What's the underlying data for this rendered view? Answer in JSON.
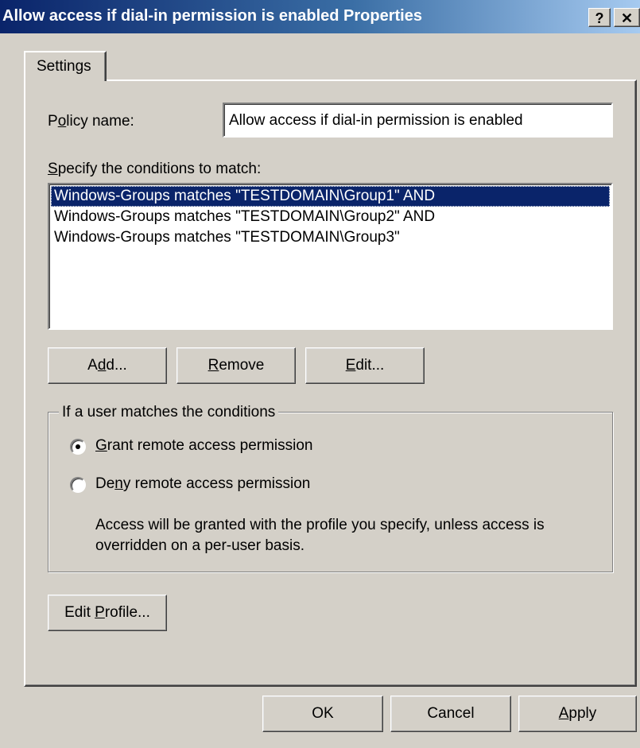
{
  "window": {
    "title": "Allow access if dial-in permission is enabled Properties",
    "help_button": "?",
    "close_button": "✕"
  },
  "tabs": [
    {
      "label": "Settings",
      "selected": true
    }
  ],
  "policy": {
    "label_prefix": "P",
    "label_accel": "o",
    "label_suffix": "licy name:",
    "value": "Allow access if dial-in permission is enabled"
  },
  "conditions": {
    "label_accel": "S",
    "label_suffix": "pecify the conditions to match:",
    "items": [
      "Windows-Groups matches \"TESTDOMAIN\\Group1\" AND",
      "Windows-Groups matches \"TESTDOMAIN\\Group2\" AND",
      "Windows-Groups matches \"TESTDOMAIN\\Group3\""
    ],
    "selected_index": 0
  },
  "condition_buttons": {
    "add": {
      "pre": "A",
      "accel": "d",
      "post": "d..."
    },
    "remove": {
      "pre": "",
      "accel": "R",
      "post": "emove"
    },
    "edit": {
      "pre": "",
      "accel": "E",
      "post": "dit..."
    }
  },
  "match_group": {
    "legend": "If a user matches the conditions",
    "grant": {
      "pre": "",
      "accel": "G",
      "post": "rant remote access permission",
      "checked": true
    },
    "deny": {
      "pre": "De",
      "accel": "n",
      "post": "y remote access permission",
      "checked": false
    },
    "note": "Access will be granted with the profile you specify, unless access is overridden on a per-user basis."
  },
  "edit_profile": {
    "pre": "Edit ",
    "accel": "P",
    "post": "rofile..."
  },
  "footer": {
    "ok": "OK",
    "cancel": "Cancel",
    "apply_accel": "A",
    "apply_post": "pply"
  }
}
